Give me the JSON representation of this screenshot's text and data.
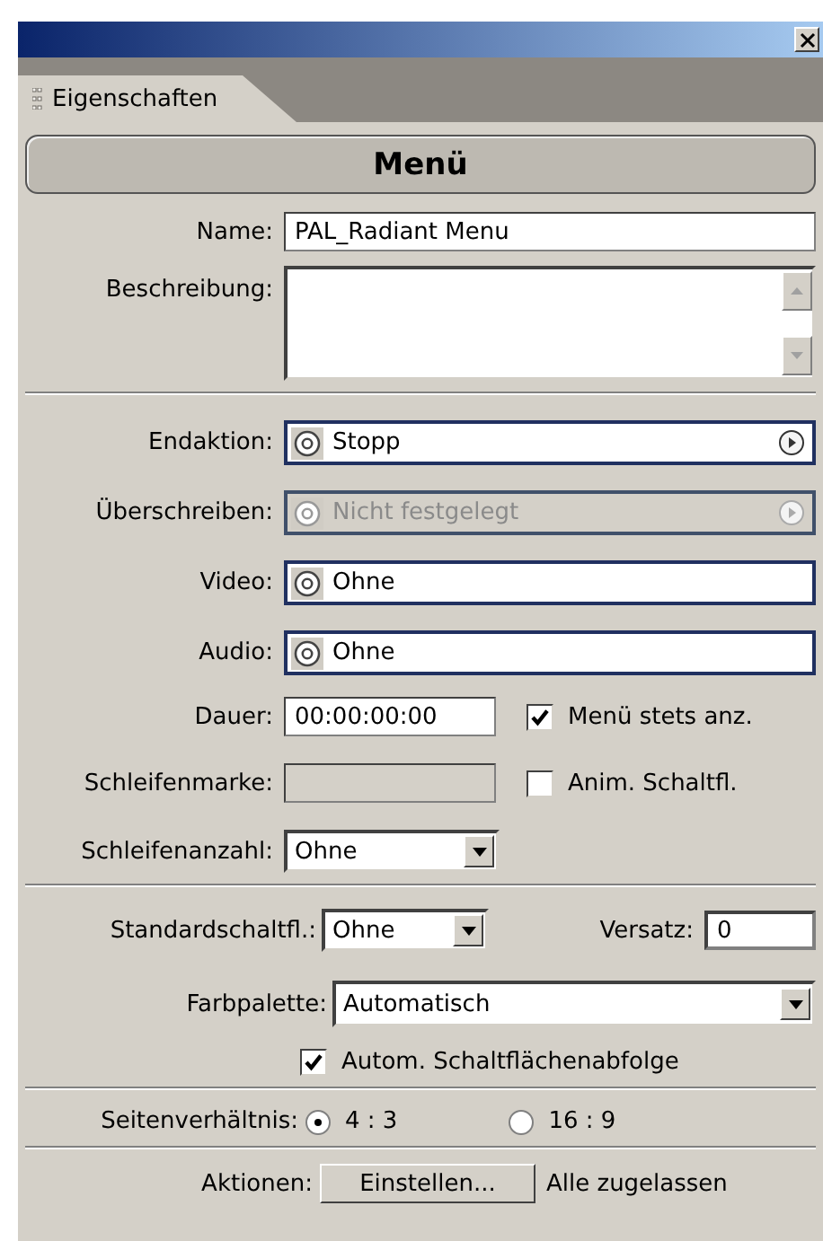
{
  "tab": {
    "label": "Eigenschaften",
    "selected": true
  },
  "header": {
    "title": "Menü"
  },
  "name": {
    "label": "Name:",
    "value": "PAL_Radiant Menu"
  },
  "description": {
    "label": "Beschreibung:"
  },
  "links": [
    {
      "label": "Endaktion:",
      "value": "Stopp",
      "disabled": false,
      "arrow": true
    },
    {
      "label": "Überschreiben:",
      "value": "Nicht festgelegt",
      "disabled": true,
      "arrow": true
    }
  ],
  "media": [
    {
      "label": "Video:",
      "value": "Ohne",
      "disabled": false,
      "arrow": false
    },
    {
      "label": "Audio:",
      "value": "Ohne",
      "disabled": false,
      "arrow": false
    }
  ],
  "duration": {
    "label": "Dauer:",
    "value": "00:00:00:00",
    "disabled": false
  },
  "loop_marker": {
    "label": "Schleifenmarke:",
    "disabled": true
  },
  "options": [
    {
      "label": "Menü stets anz.",
      "checked": true
    },
    {
      "label": "Anim. Schaltfl.",
      "checked": false
    }
  ],
  "loop_count": {
    "label": "Schleifenanzahl:",
    "value": "Ohne"
  },
  "default_button": {
    "label": "Standardschaltfl.:",
    "value": "Ohne"
  },
  "offset": {
    "label": "Versatz:",
    "value": "0"
  },
  "palette": {
    "label": "Farbpalette:",
    "value": "Automatisch"
  },
  "auto_sequence": {
    "label": "Autom. Schaltflächenabfolge",
    "checked": true
  },
  "aspect": {
    "label": "Seitenverhältnis:",
    "options": [
      {
        "label": "4 : 3",
        "selected": true
      },
      {
        "label": "16 : 9",
        "selected": false
      }
    ]
  },
  "actions": {
    "label": "Aktionen:",
    "button": "Einstellen...",
    "status": "Alle zugelassen"
  }
}
